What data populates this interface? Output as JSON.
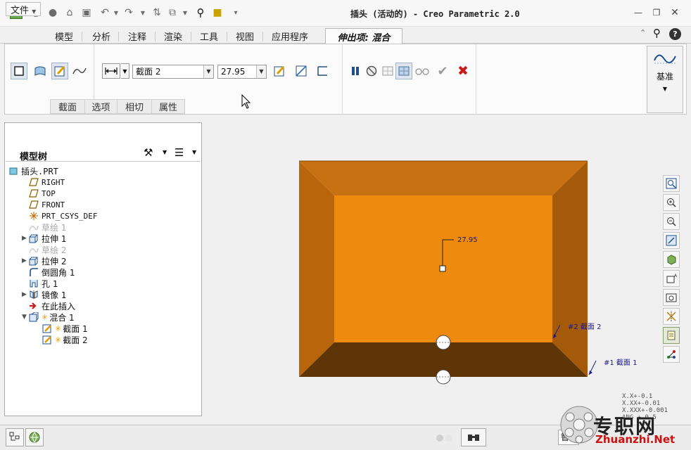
{
  "window": {
    "title": "插头 (活动的) - Creo Parametric 2.0"
  },
  "menu": {
    "file": "文件",
    "tabs": [
      "模型",
      "分析",
      "注释",
      "渲染",
      "工具",
      "视图",
      "应用程序"
    ],
    "active_tab": "伸出项: 混合"
  },
  "ribbon": {
    "section_combo": "截面 2",
    "depth_value": "27.95",
    "datum_label": "基准",
    "subtabs": [
      "截面",
      "选项",
      "相切",
      "属性"
    ]
  },
  "model_tree": {
    "title": "模型树",
    "items": [
      {
        "label": "插头.PRT",
        "icon": "part-icon",
        "indent": 0,
        "dim": false,
        "expander": ""
      },
      {
        "label": "RIGHT",
        "icon": "datum-plane-icon",
        "indent": 1,
        "dim": false,
        "expander": ""
      },
      {
        "label": "TOP",
        "icon": "datum-plane-icon",
        "indent": 1,
        "dim": false,
        "expander": ""
      },
      {
        "label": "FRONT",
        "icon": "datum-plane-icon",
        "indent": 1,
        "dim": false,
        "expander": ""
      },
      {
        "label": "PRT_CSYS_DEF",
        "icon": "csys-icon",
        "indent": 1,
        "dim": false,
        "expander": ""
      },
      {
        "label": "草绘 1",
        "icon": "sketch-icon",
        "indent": 1,
        "dim": true,
        "expander": ""
      },
      {
        "label": "拉伸 1",
        "icon": "extrude-icon",
        "indent": 1,
        "dim": false,
        "expander": "▶"
      },
      {
        "label": "草绘 2",
        "icon": "sketch-icon",
        "indent": 1,
        "dim": true,
        "expander": ""
      },
      {
        "label": "拉伸 2",
        "icon": "extrude-icon",
        "indent": 1,
        "dim": false,
        "expander": "▶"
      },
      {
        "label": "倒圆角 1",
        "icon": "round-icon",
        "indent": 1,
        "dim": false,
        "expander": ""
      },
      {
        "label": "孔 1",
        "icon": "hole-icon",
        "indent": 1,
        "dim": false,
        "expander": ""
      },
      {
        "label": "镜像 1",
        "icon": "mirror-icon",
        "indent": 1,
        "dim": false,
        "expander": "▶"
      },
      {
        "label": "在此插入",
        "icon": "insert-here-icon",
        "indent": 1,
        "dim": false,
        "expander": ""
      },
      {
        "label": "混合 1",
        "icon": "blend-icon",
        "indent": 1,
        "dim": false,
        "expander": "▼"
      },
      {
        "label": "截面 1",
        "icon": "section-icon",
        "indent": 2,
        "dim": false,
        "expander": ""
      },
      {
        "label": "截面 2",
        "icon": "section-icon",
        "indent": 2,
        "dim": false,
        "expander": ""
      }
    ]
  },
  "viewport": {
    "dimension_label": "27.95",
    "section1_label": "#1 截面 1",
    "section2_label": "#2 截面 2",
    "tolerances": [
      "X.X+-0.1",
      "X.XX+-0.01",
      "X.XXX+-0.001",
      "ANG +-0.5"
    ],
    "colors": {
      "top_face": "#ee8a0e",
      "left_face": "#b8650b",
      "right_face": "#a55a0a",
      "bottom_face": "#5e3506",
      "top_bevel": "#c77212"
    }
  },
  "statusbar": {
    "text": "智能"
  },
  "watermark": {
    "text": "专职网",
    "url": "Zhuanzhi.Net"
  }
}
